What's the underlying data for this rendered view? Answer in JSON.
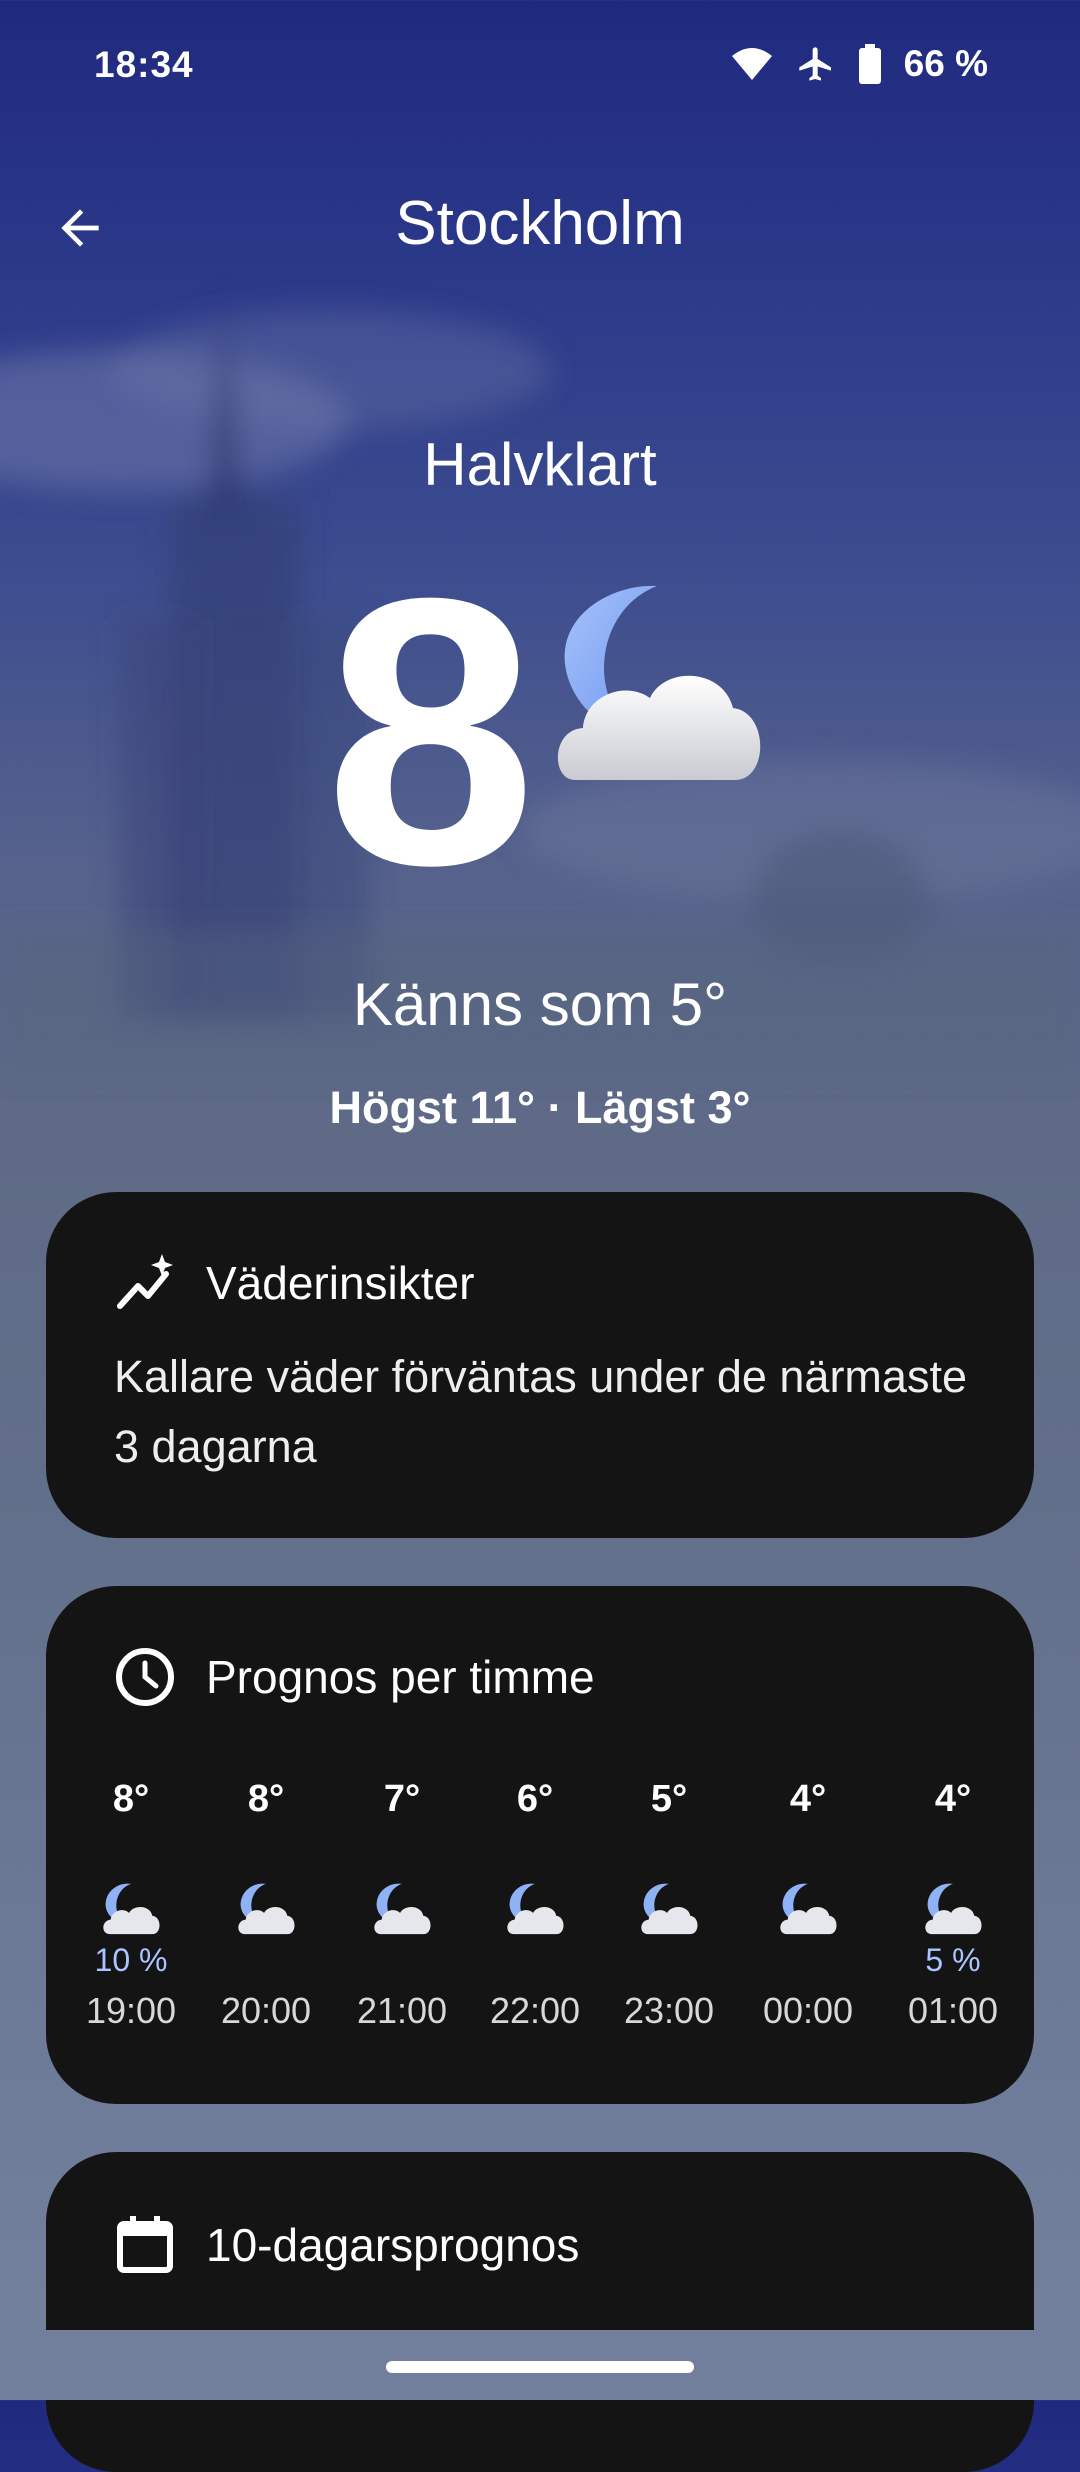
{
  "status_bar": {
    "time": "18:34",
    "battery": "66 %",
    "icons": [
      "wifi-icon",
      "airplane-mode-icon",
      "battery-icon"
    ]
  },
  "top_bar": {
    "title": "Stockholm",
    "back_icon": "arrow-left-icon"
  },
  "current": {
    "condition": "Halvklart",
    "temperature": "8",
    "icon": "partly-cloudy-night-icon",
    "feels_like": "Känns som 5°",
    "high_low": "Högst 11° · Lägst 3°"
  },
  "insights": {
    "title": "Väderinsikter",
    "icon": "sparkle-trend-icon",
    "text": "Kallare väder förväntas under de närmaste 3 dagarna"
  },
  "hourly": {
    "title": "Prognos per timme",
    "icon": "clock-icon",
    "hours": [
      {
        "temp": "8°",
        "precip": "10 %",
        "time": "19:00"
      },
      {
        "temp": "8°",
        "precip": "",
        "time": "20:00"
      },
      {
        "temp": "7°",
        "precip": "",
        "time": "21:00"
      },
      {
        "temp": "6°",
        "precip": "",
        "time": "22:00"
      },
      {
        "temp": "5°",
        "precip": "",
        "time": "23:00"
      },
      {
        "temp": "4°",
        "precip": "",
        "time": "00:00"
      },
      {
        "temp": "4°",
        "precip": "5 %",
        "time": "01:00"
      }
    ]
  },
  "ten_day": {
    "title": "10-dagarsprognos",
    "icon": "calendar-icon"
  },
  "colors": {
    "card_background": "#141414",
    "precip_text": "#a9c4ff",
    "moon": "#8fb1f5"
  }
}
